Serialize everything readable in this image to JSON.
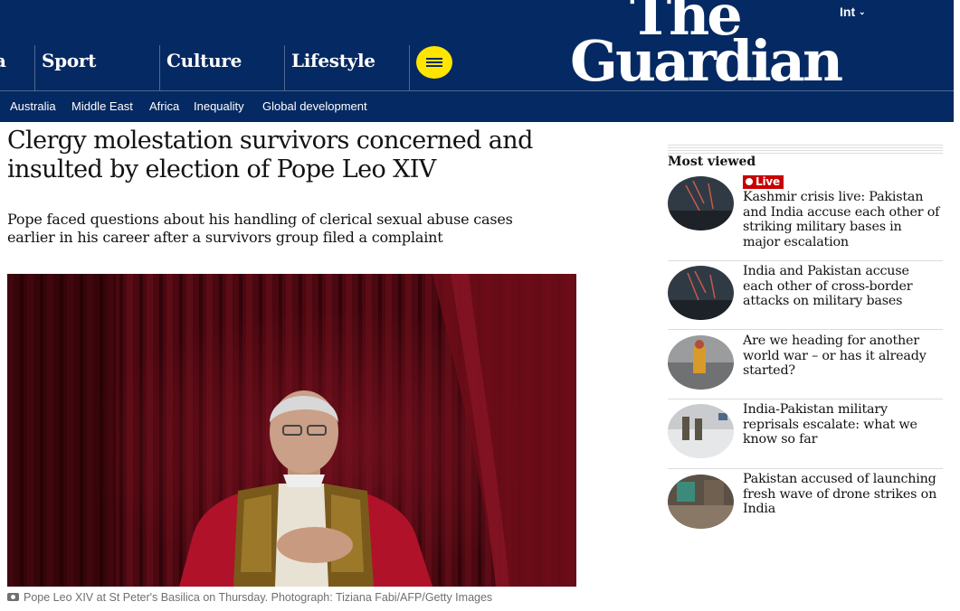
{
  "nav": {
    "pillars": [
      "Sport",
      "Culture",
      "Lifestyle"
    ],
    "edition": "Int",
    "logo_line1": "The",
    "logo_line2": "Guardian",
    "subnav": [
      "Australia",
      "Middle East",
      "Africa",
      "Inequality",
      "Global development"
    ]
  },
  "article": {
    "headline": "Clergy molestation survivors concerned and insulted by election of Pope Leo XIV",
    "standfirst": "Pope faced questions about his handling of clerical sexual abuse cases earlier in his career after a survivors group filed a complaint",
    "caption": "Pope Leo XIV at St Peter's Basilica on Thursday. Photograph: Tiziana Fabi/AFP/Getty Images"
  },
  "most_viewed": {
    "title": "Most viewed",
    "live_label": "Live",
    "items": [
      {
        "text": "Kashmir crisis live: Pakistan and India accuse each other of striking military bases in major escalation"
      },
      {
        "text": "India and Pakistan accuse each other of cross-border attacks on military bases"
      },
      {
        "text": "Are we heading for another world war – or has it already started?"
      },
      {
        "text": "India-Pakistan military reprisals escalate: what we know so far"
      },
      {
        "text": "Pakistan accused of launching fresh wave of drone strikes on India"
      }
    ]
  },
  "colors": {
    "brand_navy": "#052962",
    "menu_yellow": "#ffe500",
    "live_red": "#c70000"
  }
}
